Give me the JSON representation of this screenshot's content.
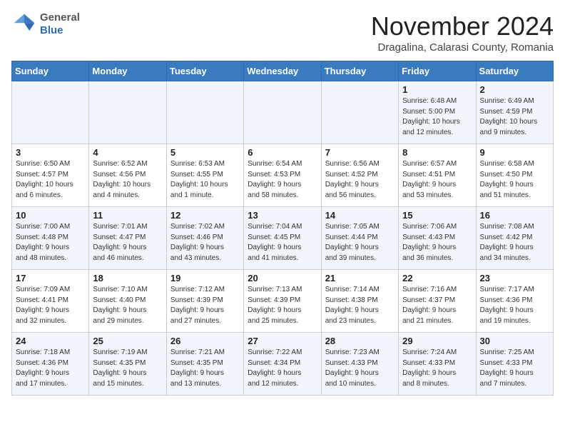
{
  "logo": {
    "general": "General",
    "blue": "Blue"
  },
  "header": {
    "month": "November 2024",
    "location": "Dragalina, Calarasi County, Romania"
  },
  "weekdays": [
    "Sunday",
    "Monday",
    "Tuesday",
    "Wednesday",
    "Thursday",
    "Friday",
    "Saturday"
  ],
  "weeks": [
    [
      {
        "day": "",
        "info": ""
      },
      {
        "day": "",
        "info": ""
      },
      {
        "day": "",
        "info": ""
      },
      {
        "day": "",
        "info": ""
      },
      {
        "day": "",
        "info": ""
      },
      {
        "day": "1",
        "info": "Sunrise: 6:48 AM\nSunset: 5:00 PM\nDaylight: 10 hours\nand 12 minutes."
      },
      {
        "day": "2",
        "info": "Sunrise: 6:49 AM\nSunset: 4:59 PM\nDaylight: 10 hours\nand 9 minutes."
      }
    ],
    [
      {
        "day": "3",
        "info": "Sunrise: 6:50 AM\nSunset: 4:57 PM\nDaylight: 10 hours\nand 6 minutes."
      },
      {
        "day": "4",
        "info": "Sunrise: 6:52 AM\nSunset: 4:56 PM\nDaylight: 10 hours\nand 4 minutes."
      },
      {
        "day": "5",
        "info": "Sunrise: 6:53 AM\nSunset: 4:55 PM\nDaylight: 10 hours\nand 1 minute."
      },
      {
        "day": "6",
        "info": "Sunrise: 6:54 AM\nSunset: 4:53 PM\nDaylight: 9 hours\nand 58 minutes."
      },
      {
        "day": "7",
        "info": "Sunrise: 6:56 AM\nSunset: 4:52 PM\nDaylight: 9 hours\nand 56 minutes."
      },
      {
        "day": "8",
        "info": "Sunrise: 6:57 AM\nSunset: 4:51 PM\nDaylight: 9 hours\nand 53 minutes."
      },
      {
        "day": "9",
        "info": "Sunrise: 6:58 AM\nSunset: 4:50 PM\nDaylight: 9 hours\nand 51 minutes."
      }
    ],
    [
      {
        "day": "10",
        "info": "Sunrise: 7:00 AM\nSunset: 4:48 PM\nDaylight: 9 hours\nand 48 minutes."
      },
      {
        "day": "11",
        "info": "Sunrise: 7:01 AM\nSunset: 4:47 PM\nDaylight: 9 hours\nand 46 minutes."
      },
      {
        "day": "12",
        "info": "Sunrise: 7:02 AM\nSunset: 4:46 PM\nDaylight: 9 hours\nand 43 minutes."
      },
      {
        "day": "13",
        "info": "Sunrise: 7:04 AM\nSunset: 4:45 PM\nDaylight: 9 hours\nand 41 minutes."
      },
      {
        "day": "14",
        "info": "Sunrise: 7:05 AM\nSunset: 4:44 PM\nDaylight: 9 hours\nand 39 minutes."
      },
      {
        "day": "15",
        "info": "Sunrise: 7:06 AM\nSunset: 4:43 PM\nDaylight: 9 hours\nand 36 minutes."
      },
      {
        "day": "16",
        "info": "Sunrise: 7:08 AM\nSunset: 4:42 PM\nDaylight: 9 hours\nand 34 minutes."
      }
    ],
    [
      {
        "day": "17",
        "info": "Sunrise: 7:09 AM\nSunset: 4:41 PM\nDaylight: 9 hours\nand 32 minutes."
      },
      {
        "day": "18",
        "info": "Sunrise: 7:10 AM\nSunset: 4:40 PM\nDaylight: 9 hours\nand 29 minutes."
      },
      {
        "day": "19",
        "info": "Sunrise: 7:12 AM\nSunset: 4:39 PM\nDaylight: 9 hours\nand 27 minutes."
      },
      {
        "day": "20",
        "info": "Sunrise: 7:13 AM\nSunset: 4:39 PM\nDaylight: 9 hours\nand 25 minutes."
      },
      {
        "day": "21",
        "info": "Sunrise: 7:14 AM\nSunset: 4:38 PM\nDaylight: 9 hours\nand 23 minutes."
      },
      {
        "day": "22",
        "info": "Sunrise: 7:16 AM\nSunset: 4:37 PM\nDaylight: 9 hours\nand 21 minutes."
      },
      {
        "day": "23",
        "info": "Sunrise: 7:17 AM\nSunset: 4:36 PM\nDaylight: 9 hours\nand 19 minutes."
      }
    ],
    [
      {
        "day": "24",
        "info": "Sunrise: 7:18 AM\nSunset: 4:36 PM\nDaylight: 9 hours\nand 17 minutes."
      },
      {
        "day": "25",
        "info": "Sunrise: 7:19 AM\nSunset: 4:35 PM\nDaylight: 9 hours\nand 15 minutes."
      },
      {
        "day": "26",
        "info": "Sunrise: 7:21 AM\nSunset: 4:35 PM\nDaylight: 9 hours\nand 13 minutes."
      },
      {
        "day": "27",
        "info": "Sunrise: 7:22 AM\nSunset: 4:34 PM\nDaylight: 9 hours\nand 12 minutes."
      },
      {
        "day": "28",
        "info": "Sunrise: 7:23 AM\nSunset: 4:33 PM\nDaylight: 9 hours\nand 10 minutes."
      },
      {
        "day": "29",
        "info": "Sunrise: 7:24 AM\nSunset: 4:33 PM\nDaylight: 9 hours\nand 8 minutes."
      },
      {
        "day": "30",
        "info": "Sunrise: 7:25 AM\nSunset: 4:33 PM\nDaylight: 9 hours\nand 7 minutes."
      }
    ]
  ]
}
